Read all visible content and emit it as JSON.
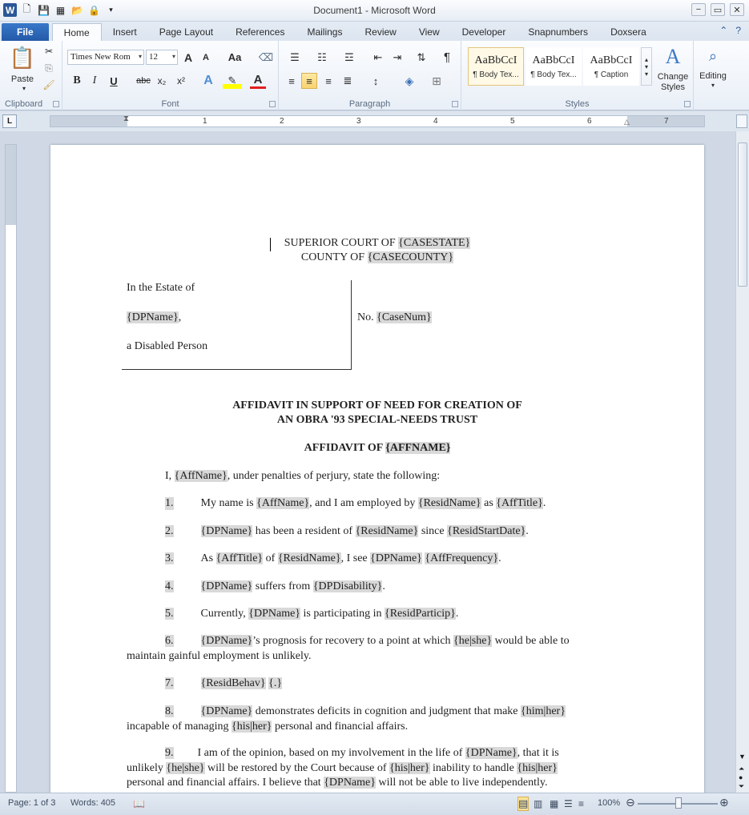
{
  "window": {
    "title": "Document1 - Microsoft Word",
    "controls": [
      "−",
      "▭",
      "✕"
    ]
  },
  "tabs": [
    "File",
    "Home",
    "Insert",
    "Page Layout",
    "References",
    "Mailings",
    "Review",
    "View",
    "Developer",
    "Snapnumbers",
    "Doxsera"
  ],
  "ribbon": {
    "clipboard": {
      "label": "Clipboard",
      "paste": "Paste"
    },
    "font": {
      "label": "Font",
      "font_name": "Times New Rom",
      "font_size": "12",
      "bold": "B",
      "italic": "I",
      "underline": "U",
      "strike": "abc",
      "sub": "x₂",
      "sup": "x²",
      "case": "Aa",
      "grow": "A",
      "shrink": "A"
    },
    "paragraph": {
      "label": "Paragraph",
      "pilcrow": "¶"
    },
    "styles": {
      "label": "Styles",
      "items": [
        {
          "sample": "AaBbCcI",
          "name": "¶ Body Tex..."
        },
        {
          "sample": "AaBbCcI",
          "name": "¶ Body Tex..."
        },
        {
          "sample": "AaBbCcI",
          "name": "¶ Caption"
        }
      ],
      "change_styles": "Change Styles"
    },
    "editing": {
      "label": "Editing"
    }
  },
  "ruler": {
    "box": "L",
    "numbers": [
      "1",
      "2",
      "3",
      "4",
      "5",
      "6",
      "7"
    ]
  },
  "document": {
    "court_line1_a": "SUPERIOR COURT OF ",
    "court_line1_field": "{CASESTATE}",
    "court_line2_a": "COUNTY OF ",
    "court_line2_field": "{CASECOUNTY}",
    "estate": "In the Estate of",
    "dpname_field": "{DPName}",
    "dpname_comma": ",",
    "disabled": "a Disabled  Person",
    "no_label": "No. ",
    "casenum_field": "{CaseNum}",
    "title1": "AFFIDAVIT  IN SUPPORT  OF NEED FOR CREATION  OF",
    "title2": "AN OBRA '93 SPECIAL-NEEDS  TRUST",
    "aff_title": "AFFIDAVIT  OF ",
    "affname_upper": "{AFFNAME}",
    "intro_a": "I, ",
    "affname": "{AffName}",
    "intro_b": ",  under  penalties  of perjury,  state the following:",
    "p1": {
      "num": "1.",
      "a": "My name  is ",
      "f1": "{AffName}",
      "b": ",  and I am employed  by ",
      "f2": "{ResidName}",
      "c": "  as ",
      "f3": "{AffTitle}",
      "d": "."
    },
    "p2": {
      "num": "2.",
      "f1": "{DPName}",
      "a": " has been a resident  of ",
      "f2": "{ResidName}",
      "b": "  since  ",
      "f3": "{ResidStartDate}",
      "c": "."
    },
    "p3": {
      "num": "3.",
      "a": "As ",
      "f1": "{AffTitle}",
      "b": "  of ",
      "f2": "{ResidName}",
      "c": ", I see ",
      "f3": "{DPName}",
      "d": "  ",
      "f4": "{AffFrequency}",
      "e": "."
    },
    "p4": {
      "num": "4.",
      "f1": "{DPName}",
      "a": "  suffers  from  ",
      "f2": "{DPDisability}",
      "b": "."
    },
    "p5": {
      "num": "5.",
      "a": "Currently,  ",
      "f1": "{DPName}",
      "b": "  is participating  in  ",
      "f2": "{ResidParticip}",
      "c": "."
    },
    "p6": {
      "num": "6.",
      "f1": "{DPName}",
      "a": "’s prognosis  for recovery  to a point  at which  ",
      "f2": "{he|she}",
      "b": "  would  be able to",
      "line2": "maintain  gainful  employment  is unlikely."
    },
    "p7": {
      "num": "7.",
      "f1": "{ResidBehav}",
      "f2": "{.}"
    },
    "p8": {
      "num": "8.",
      "f1": "{DPName}",
      "a": "  demonstrates  deficits  in cognition  and judgment  that make  ",
      "f2": "{him|her}",
      "line2a": "incapable  of managing  ",
      "f3": "{his|her}",
      "line2b": "  personal  and financial  affairs."
    },
    "p9": {
      "num": "9.",
      "a": "I am of the opinion,  based on my involvement  in the life  of ",
      "f1": "{DPName}",
      "b": ", that it is",
      "l2a": "unlikely  ",
      "f2": "{he|she}",
      "l2b": "  will  be restored by the Court because of  ",
      "f3": "{his|her}",
      "l2c": "  inability  to handle  ",
      "f4": "{his|her}",
      "l3a": "personal  and financial  affairs.  I believe  that  ",
      "f5": "{DPName}",
      "l3b": "  will  not  be able to live  independently."
    }
  },
  "status": {
    "page": "Page: 1 of 3",
    "words": "Words: 405",
    "zoom": "100%"
  }
}
